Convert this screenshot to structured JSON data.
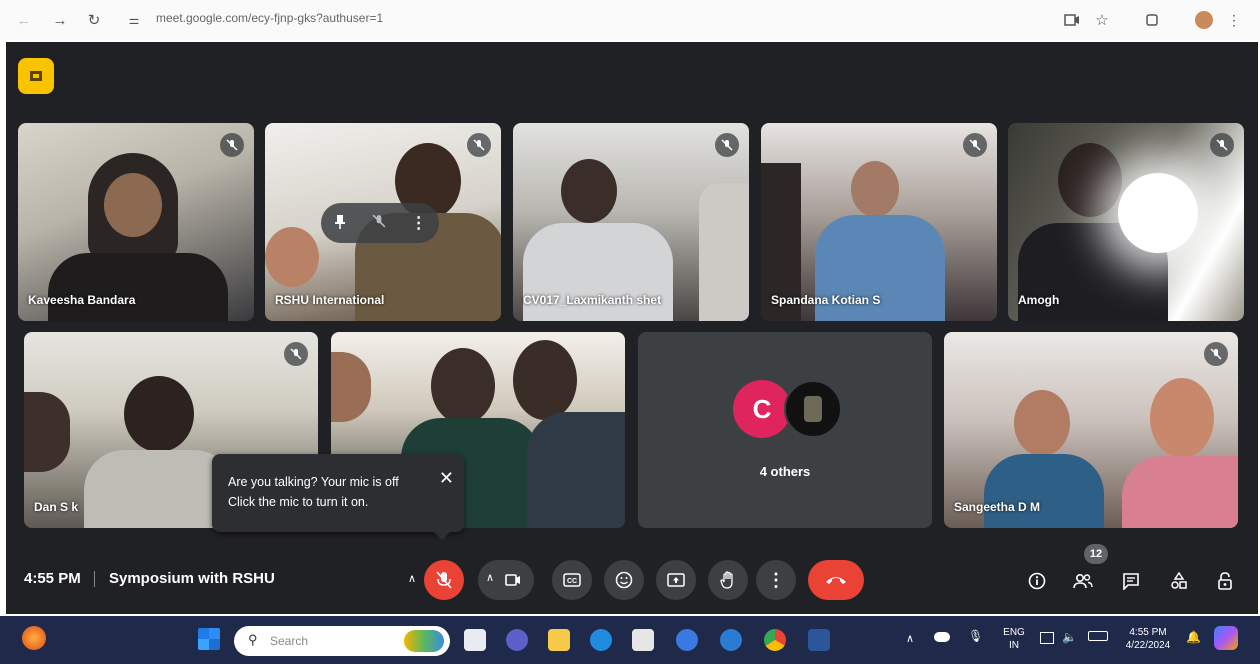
{
  "browser": {
    "url": "meet.google.com/ecy-fjnp-gks?authuser=1"
  },
  "tiles": [
    {
      "name": "Kaveesha Bandara"
    },
    {
      "name": "RSHU International"
    },
    {
      "name": "CV017_Laxmikanth shet"
    },
    {
      "name": "Spandana Kotian S"
    },
    {
      "name": "Amogh"
    },
    {
      "name": "Dan S k"
    },
    {
      "name": ""
    },
    {
      "name": "Sangeetha D M"
    }
  ],
  "others": {
    "avatar_letter": "C",
    "label": "4 others"
  },
  "tooltip": {
    "line1": "Are you talking? Your mic is off",
    "line2": "Click the mic to turn it on."
  },
  "bottombar": {
    "time": "4:55 PM",
    "title": "Symposium with RSHU",
    "people_count": "12"
  },
  "taskbar": {
    "search_placeholder": "Search",
    "lang_top": "ENG",
    "lang_bottom": "IN",
    "clock_time": "4:55 PM",
    "clock_date": "4/22/2024"
  },
  "colors": {
    "meet_bg": "#202124",
    "end_call": "#ea4335",
    "mic_off": "#ea4335",
    "accent_yellow": "#f9c300",
    "taskbar": "#1f2a4a"
  }
}
